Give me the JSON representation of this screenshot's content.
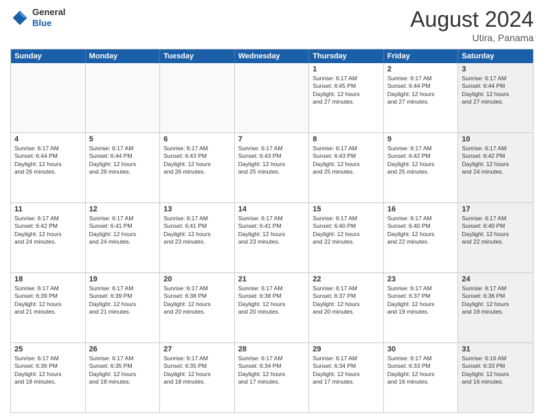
{
  "header": {
    "logo_general": "General",
    "logo_blue": "Blue",
    "month_year": "August 2024",
    "location": "Utira, Panama"
  },
  "weekdays": [
    "Sunday",
    "Monday",
    "Tuesday",
    "Wednesday",
    "Thursday",
    "Friday",
    "Saturday"
  ],
  "rows": [
    [
      {
        "day": "",
        "text": "",
        "empty": true
      },
      {
        "day": "",
        "text": "",
        "empty": true
      },
      {
        "day": "",
        "text": "",
        "empty": true
      },
      {
        "day": "",
        "text": "",
        "empty": true
      },
      {
        "day": "1",
        "text": "Sunrise: 6:17 AM\nSunset: 6:45 PM\nDaylight: 12 hours\nand 27 minutes."
      },
      {
        "day": "2",
        "text": "Sunrise: 6:17 AM\nSunset: 6:44 PM\nDaylight: 12 hours\nand 27 minutes."
      },
      {
        "day": "3",
        "text": "Sunrise: 6:17 AM\nSunset: 6:44 PM\nDaylight: 12 hours\nand 27 minutes.",
        "shaded": true
      }
    ],
    [
      {
        "day": "4",
        "text": "Sunrise: 6:17 AM\nSunset: 6:44 PM\nDaylight: 12 hours\nand 26 minutes."
      },
      {
        "day": "5",
        "text": "Sunrise: 6:17 AM\nSunset: 6:44 PM\nDaylight: 12 hours\nand 26 minutes."
      },
      {
        "day": "6",
        "text": "Sunrise: 6:17 AM\nSunset: 6:43 PM\nDaylight: 12 hours\nand 26 minutes."
      },
      {
        "day": "7",
        "text": "Sunrise: 6:17 AM\nSunset: 6:43 PM\nDaylight: 12 hours\nand 25 minutes."
      },
      {
        "day": "8",
        "text": "Sunrise: 6:17 AM\nSunset: 6:43 PM\nDaylight: 12 hours\nand 25 minutes."
      },
      {
        "day": "9",
        "text": "Sunrise: 6:17 AM\nSunset: 6:42 PM\nDaylight: 12 hours\nand 25 minutes."
      },
      {
        "day": "10",
        "text": "Sunrise: 6:17 AM\nSunset: 6:42 PM\nDaylight: 12 hours\nand 24 minutes.",
        "shaded": true
      }
    ],
    [
      {
        "day": "11",
        "text": "Sunrise: 6:17 AM\nSunset: 6:42 PM\nDaylight: 12 hours\nand 24 minutes."
      },
      {
        "day": "12",
        "text": "Sunrise: 6:17 AM\nSunset: 6:41 PM\nDaylight: 12 hours\nand 24 minutes."
      },
      {
        "day": "13",
        "text": "Sunrise: 6:17 AM\nSunset: 6:41 PM\nDaylight: 12 hours\nand 23 minutes."
      },
      {
        "day": "14",
        "text": "Sunrise: 6:17 AM\nSunset: 6:41 PM\nDaylight: 12 hours\nand 23 minutes."
      },
      {
        "day": "15",
        "text": "Sunrise: 6:17 AM\nSunset: 6:40 PM\nDaylight: 12 hours\nand 22 minutes."
      },
      {
        "day": "16",
        "text": "Sunrise: 6:17 AM\nSunset: 6:40 PM\nDaylight: 12 hours\nand 22 minutes."
      },
      {
        "day": "17",
        "text": "Sunrise: 6:17 AM\nSunset: 6:40 PM\nDaylight: 12 hours\nand 22 minutes.",
        "shaded": true
      }
    ],
    [
      {
        "day": "18",
        "text": "Sunrise: 6:17 AM\nSunset: 6:39 PM\nDaylight: 12 hours\nand 21 minutes."
      },
      {
        "day": "19",
        "text": "Sunrise: 6:17 AM\nSunset: 6:39 PM\nDaylight: 12 hours\nand 21 minutes."
      },
      {
        "day": "20",
        "text": "Sunrise: 6:17 AM\nSunset: 6:38 PM\nDaylight: 12 hours\nand 20 minutes."
      },
      {
        "day": "21",
        "text": "Sunrise: 6:17 AM\nSunset: 6:38 PM\nDaylight: 12 hours\nand 20 minutes."
      },
      {
        "day": "22",
        "text": "Sunrise: 6:17 AM\nSunset: 6:37 PM\nDaylight: 12 hours\nand 20 minutes."
      },
      {
        "day": "23",
        "text": "Sunrise: 6:17 AM\nSunset: 6:37 PM\nDaylight: 12 hours\nand 19 minutes."
      },
      {
        "day": "24",
        "text": "Sunrise: 6:17 AM\nSunset: 6:36 PM\nDaylight: 12 hours\nand 19 minutes.",
        "shaded": true
      }
    ],
    [
      {
        "day": "25",
        "text": "Sunrise: 6:17 AM\nSunset: 6:36 PM\nDaylight: 12 hours\nand 18 minutes."
      },
      {
        "day": "26",
        "text": "Sunrise: 6:17 AM\nSunset: 6:35 PM\nDaylight: 12 hours\nand 18 minutes."
      },
      {
        "day": "27",
        "text": "Sunrise: 6:17 AM\nSunset: 6:35 PM\nDaylight: 12 hours\nand 18 minutes."
      },
      {
        "day": "28",
        "text": "Sunrise: 6:17 AM\nSunset: 6:34 PM\nDaylight: 12 hours\nand 17 minutes."
      },
      {
        "day": "29",
        "text": "Sunrise: 6:17 AM\nSunset: 6:34 PM\nDaylight: 12 hours\nand 17 minutes."
      },
      {
        "day": "30",
        "text": "Sunrise: 6:17 AM\nSunset: 6:33 PM\nDaylight: 12 hours\nand 16 minutes."
      },
      {
        "day": "31",
        "text": "Sunrise: 6:16 AM\nSunset: 6:33 PM\nDaylight: 12 hours\nand 16 minutes.",
        "shaded": true
      }
    ]
  ]
}
